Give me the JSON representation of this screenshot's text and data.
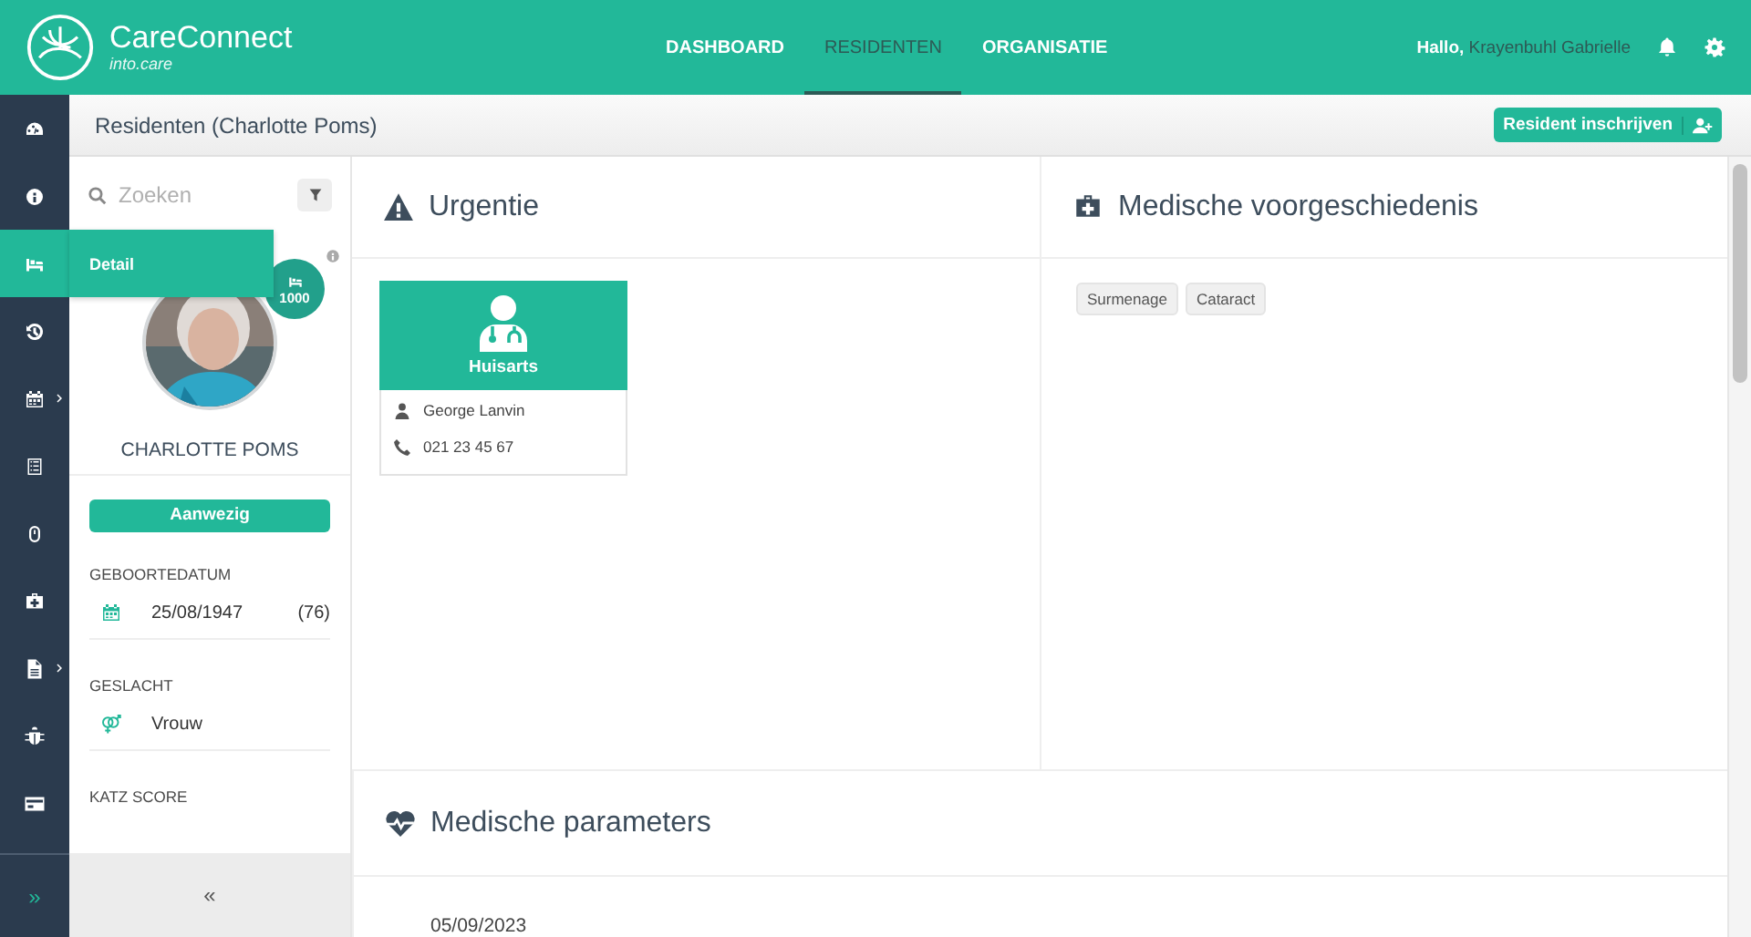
{
  "header": {
    "logo_title": "CareConnect",
    "logo_subtitle": "into.care",
    "nav": [
      {
        "label": "DASHBOARD",
        "selected": false
      },
      {
        "label": "RESIDENTEN",
        "selected": true
      },
      {
        "label": "ORGANISATIE",
        "selected": false
      }
    ],
    "greeting": "Hallo,",
    "user": "Krayenbuhl Gabrielle"
  },
  "sidebar": {
    "items": [
      {
        "kind": "dashboard",
        "selected": false,
        "submenu": false
      },
      {
        "kind": "info",
        "selected": false,
        "submenu": false
      },
      {
        "kind": "bed",
        "selected": true,
        "submenu": false
      },
      {
        "kind": "history",
        "selected": false,
        "submenu": false
      },
      {
        "kind": "calendar",
        "selected": false,
        "submenu": true
      },
      {
        "kind": "list",
        "selected": false,
        "submenu": false
      },
      {
        "kind": "mouse",
        "selected": false,
        "submenu": false
      },
      {
        "kind": "medkit",
        "selected": false,
        "submenu": false
      },
      {
        "kind": "document",
        "selected": false,
        "submenu": true
      },
      {
        "kind": "bug",
        "selected": false,
        "submenu": false
      },
      {
        "kind": "card",
        "selected": false,
        "submenu": false
      }
    ],
    "tooltip": "Detail",
    "expand": "»"
  },
  "subheader": {
    "title": "Residenten (Charlotte Poms)",
    "button": "Resident inschrijven"
  },
  "resident_panel": {
    "search_placeholder": "Zoeken",
    "room": "1000",
    "name": "CHARLOTTE POMS",
    "status": "Aanwezig",
    "fields": [
      {
        "label": "GEBOORTEDATUM",
        "kind": "date",
        "value": "25/08/1947",
        "extra": "(76)"
      },
      {
        "label": "GESLACHT",
        "kind": "gender",
        "value": "Vrouw"
      }
    ],
    "next_label": "KATZ SCORE",
    "collapse": "«"
  },
  "urgentie": {
    "title": "Urgentie",
    "contacts": [
      {
        "role": "Huisarts",
        "name": "George Lanvin",
        "phone": "021 23 45 67"
      }
    ]
  },
  "history": {
    "title": "Medische voorgeschiedenis",
    "tags": [
      "Surmenage",
      "Cataract"
    ]
  },
  "parameters": {
    "title": "Medische parameters",
    "date": "05/09/2023"
  }
}
